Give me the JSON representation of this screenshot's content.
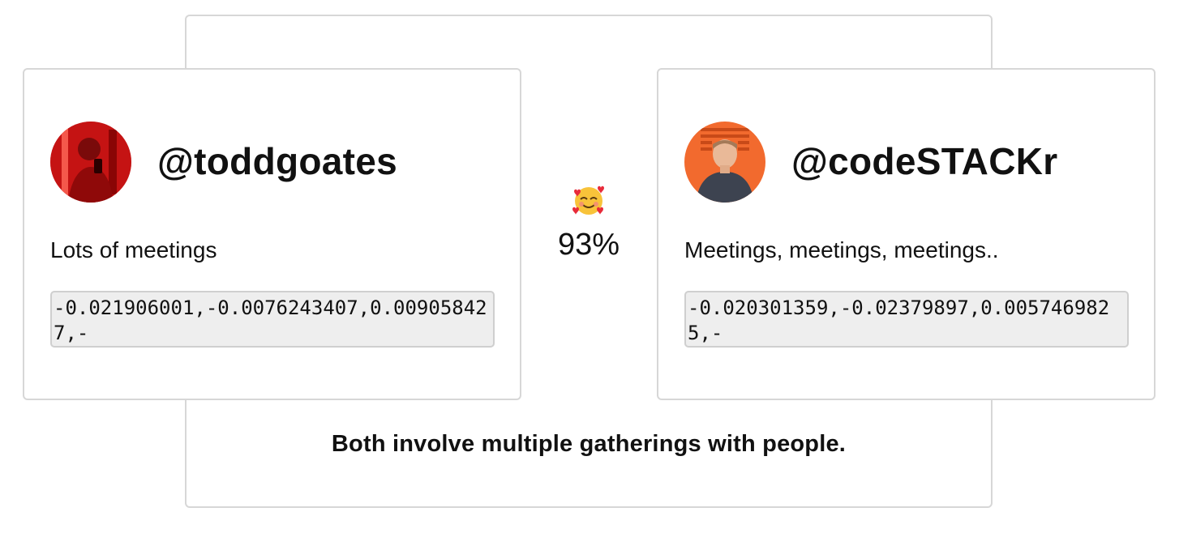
{
  "summary": "Both involve multiple gatherings with people.",
  "match": {
    "icon": "smiling-face-with-hearts-icon",
    "percent": "93%"
  },
  "left_user": {
    "handle": "@toddgoates",
    "bio": "Lots of meetings",
    "embedding": "-0.021906001,-0.0076243407,0.009058427,-",
    "avatar_color": "#c41212"
  },
  "right_user": {
    "handle": "@codeSTACKr",
    "bio": "Meetings, meetings, meetings..",
    "embedding": "-0.020301359,-0.02379897,0.0057469825,-",
    "avatar_color": "#f26a2e"
  }
}
